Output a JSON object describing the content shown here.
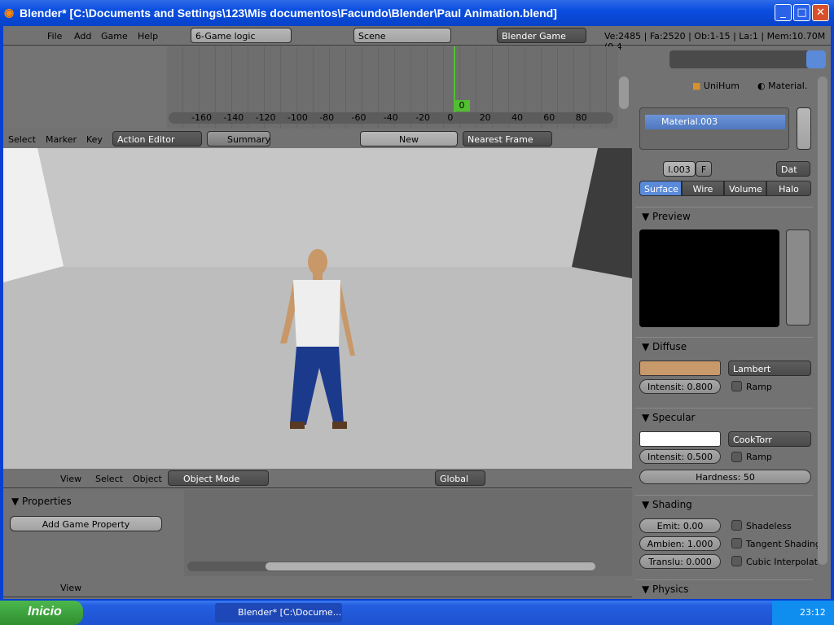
{
  "window": {
    "title": "Blender* [C:\\Documents and Settings\\123\\Mis documentos\\Facundo\\Blender\\Paul Animation.blend]"
  },
  "info_header": {
    "menus": [
      "File",
      "Add",
      "Game",
      "Help"
    ],
    "screen": "6-Game logic",
    "scene": "Scene",
    "engine": "Blender Game",
    "stats": "Ve:2485 | Fa:2520 | Ob:1-15 | La:1 | Mem:10.70M (0.4"
  },
  "timeline": {
    "ticks": [
      "-160",
      "-140",
      "-120",
      "-100",
      "-80",
      "-60",
      "-40",
      "-20",
      "0",
      "20",
      "40",
      "60",
      "80"
    ],
    "current_frame": "0"
  },
  "action_header": {
    "menus": [
      "Select",
      "Marker",
      "Key"
    ],
    "mode": "Action Editor",
    "summary": "Summary",
    "new": "New",
    "snap": "Nearest Frame"
  },
  "view3d_header": {
    "menus": [
      "View",
      "Select",
      "Object"
    ],
    "mode": "Object Mode",
    "orientation": "Global"
  },
  "logic": {
    "panel_title": "Properties",
    "add_button": "Add Game Property",
    "header_menu": "View"
  },
  "properties": {
    "breadcrumb": [
      "UniHum",
      "Material."
    ],
    "material_slot": "Material.003",
    "material_name": "l.003",
    "fake": "F",
    "data": "Dat",
    "tabs": [
      "Surface",
      "Wire",
      "Volume",
      "Halo"
    ],
    "active_tab": "Surface",
    "preview_title": "Preview",
    "diffuse": {
      "title": "Diffuse",
      "color": "#c8996a",
      "shader": "Lambert",
      "intensity": "Intensit: 0.800",
      "intensity_value": 0.8,
      "ramp": "Ramp"
    },
    "specular": {
      "title": "Specular",
      "color": "#ffffff",
      "shader": "CookTorr",
      "intensity": "Intensit: 0.500",
      "intensity_value": 0.5,
      "ramp": "Ramp",
      "hardness": "Hardness: 50"
    },
    "shading": {
      "title": "Shading",
      "emit": "Emit: 0.00",
      "ambient": "Ambien: 1.000",
      "translucency": "Translu: 0.000",
      "shadeless": "Shadeless",
      "tangent": "Tangent Shading",
      "cubic": "Cubic Interpolat"
    },
    "physics_title": "Physics"
  },
  "taskbar": {
    "start": "Inicio",
    "task": "Blender* [C:\\Docume...",
    "clock": "23:12"
  }
}
